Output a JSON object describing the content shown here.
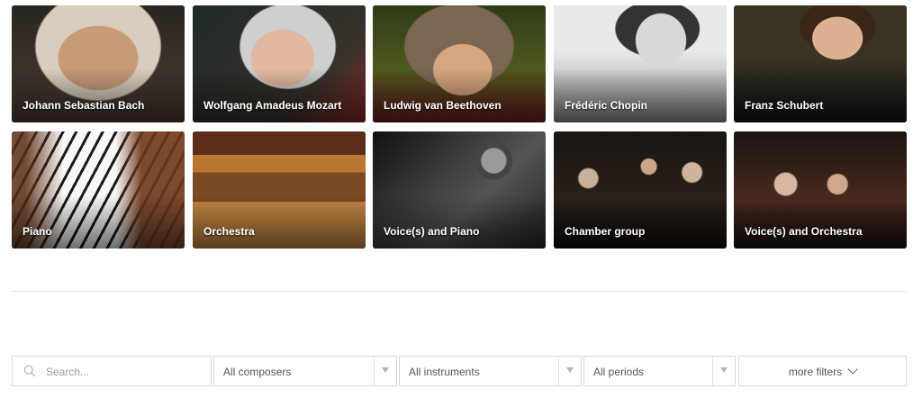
{
  "composers": [
    {
      "name": "Johann Sebastian Bach"
    },
    {
      "name": "Wolfgang Amadeus Mozart"
    },
    {
      "name": "Ludwig van Beethoven"
    },
    {
      "name": "Frédéric Chopin"
    },
    {
      "name": "Franz Schubert"
    }
  ],
  "categories": [
    {
      "name": "Piano"
    },
    {
      "name": "Orchestra"
    },
    {
      "name": "Voice(s) and Piano"
    },
    {
      "name": "Chamber group"
    },
    {
      "name": "Voice(s) and Orchestra"
    }
  ],
  "filters": {
    "search_placeholder": "Search...",
    "composers_value": "All composers",
    "instruments_value": "All instruments",
    "periods_value": "All periods",
    "more_filters_label": "more filters"
  },
  "icons": {
    "search": "search-icon",
    "dropdown": "chevron-down-icon"
  }
}
